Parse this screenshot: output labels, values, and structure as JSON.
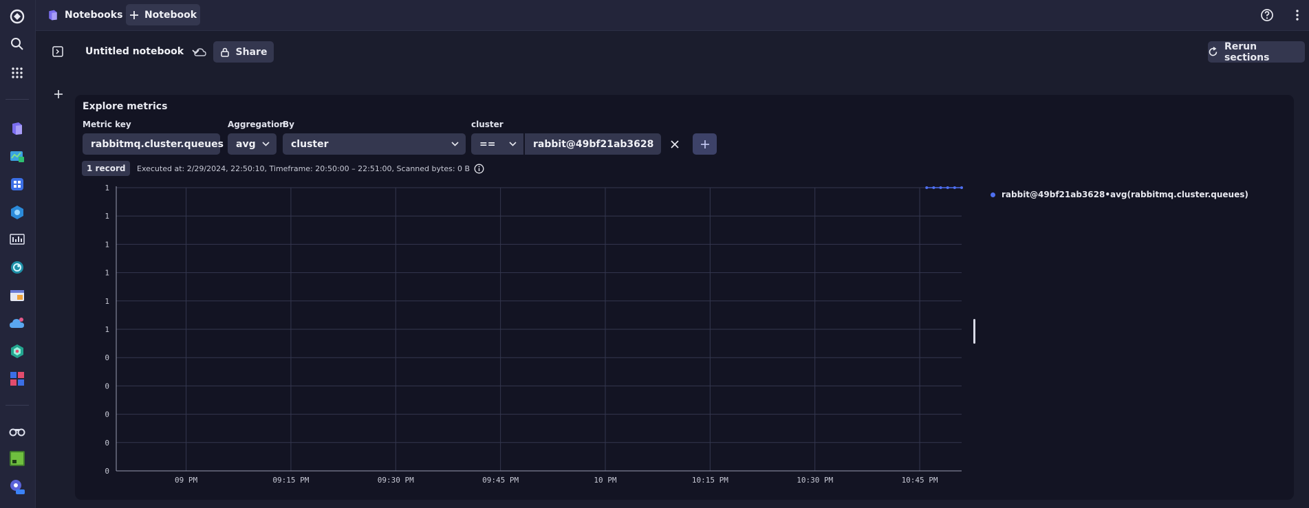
{
  "topbar": {
    "app_label": "Notebooks",
    "new_tab_label": "Notebook"
  },
  "toolbar": {
    "notebook_title": "Untitled notebook",
    "share_label": "Share",
    "rerun_label": "Rerun sections"
  },
  "section": {
    "title": "Explore metrics",
    "metric_key_label": "Metric key",
    "metric_key_value": "rabbitmq.cluster.queues",
    "aggregation_label": "Aggregation",
    "aggregation_value": "avg",
    "by_label": "By",
    "by_value": "cluster",
    "filter_label": "cluster",
    "filter_operator": "==",
    "filter_value": "rabbit@49bf21ab3628",
    "record_badge": "1 record",
    "exec_info": "Executed at: 2/29/2024, 22:50:10, Timeframe: 20:50:00 – 22:51:00, Scanned bytes: 0 B"
  },
  "chart_data": {
    "type": "line",
    "y_tick_labels": [
      "1",
      "1",
      "1",
      "1",
      "1",
      "1",
      "0",
      "0",
      "0",
      "0",
      "0"
    ],
    "x_tick_labels": [
      "09 PM",
      "09:15 PM",
      "09:30 PM",
      "09:45 PM",
      "10 PM",
      "10:15 PM",
      "10:30 PM",
      "10:45 PM"
    ],
    "x_range_minutes": [
      "20:50",
      "22:51"
    ],
    "series": [
      {
        "name": "rabbit@49bf21ab3628•avg(rabbitmq.cluster.queues)",
        "color": "#4e6ff0",
        "x": [
          "22:46",
          "22:47",
          "22:48",
          "22:49",
          "22:50",
          "22:51"
        ],
        "values": [
          1,
          1,
          1,
          1,
          1,
          1
        ]
      }
    ],
    "ylim": [
      0,
      1
    ],
    "grid": true,
    "legend_position": "right"
  },
  "colors": {
    "accent": "#4e6ff0",
    "panel_bg": "#131423",
    "control_bg": "#34374f"
  }
}
